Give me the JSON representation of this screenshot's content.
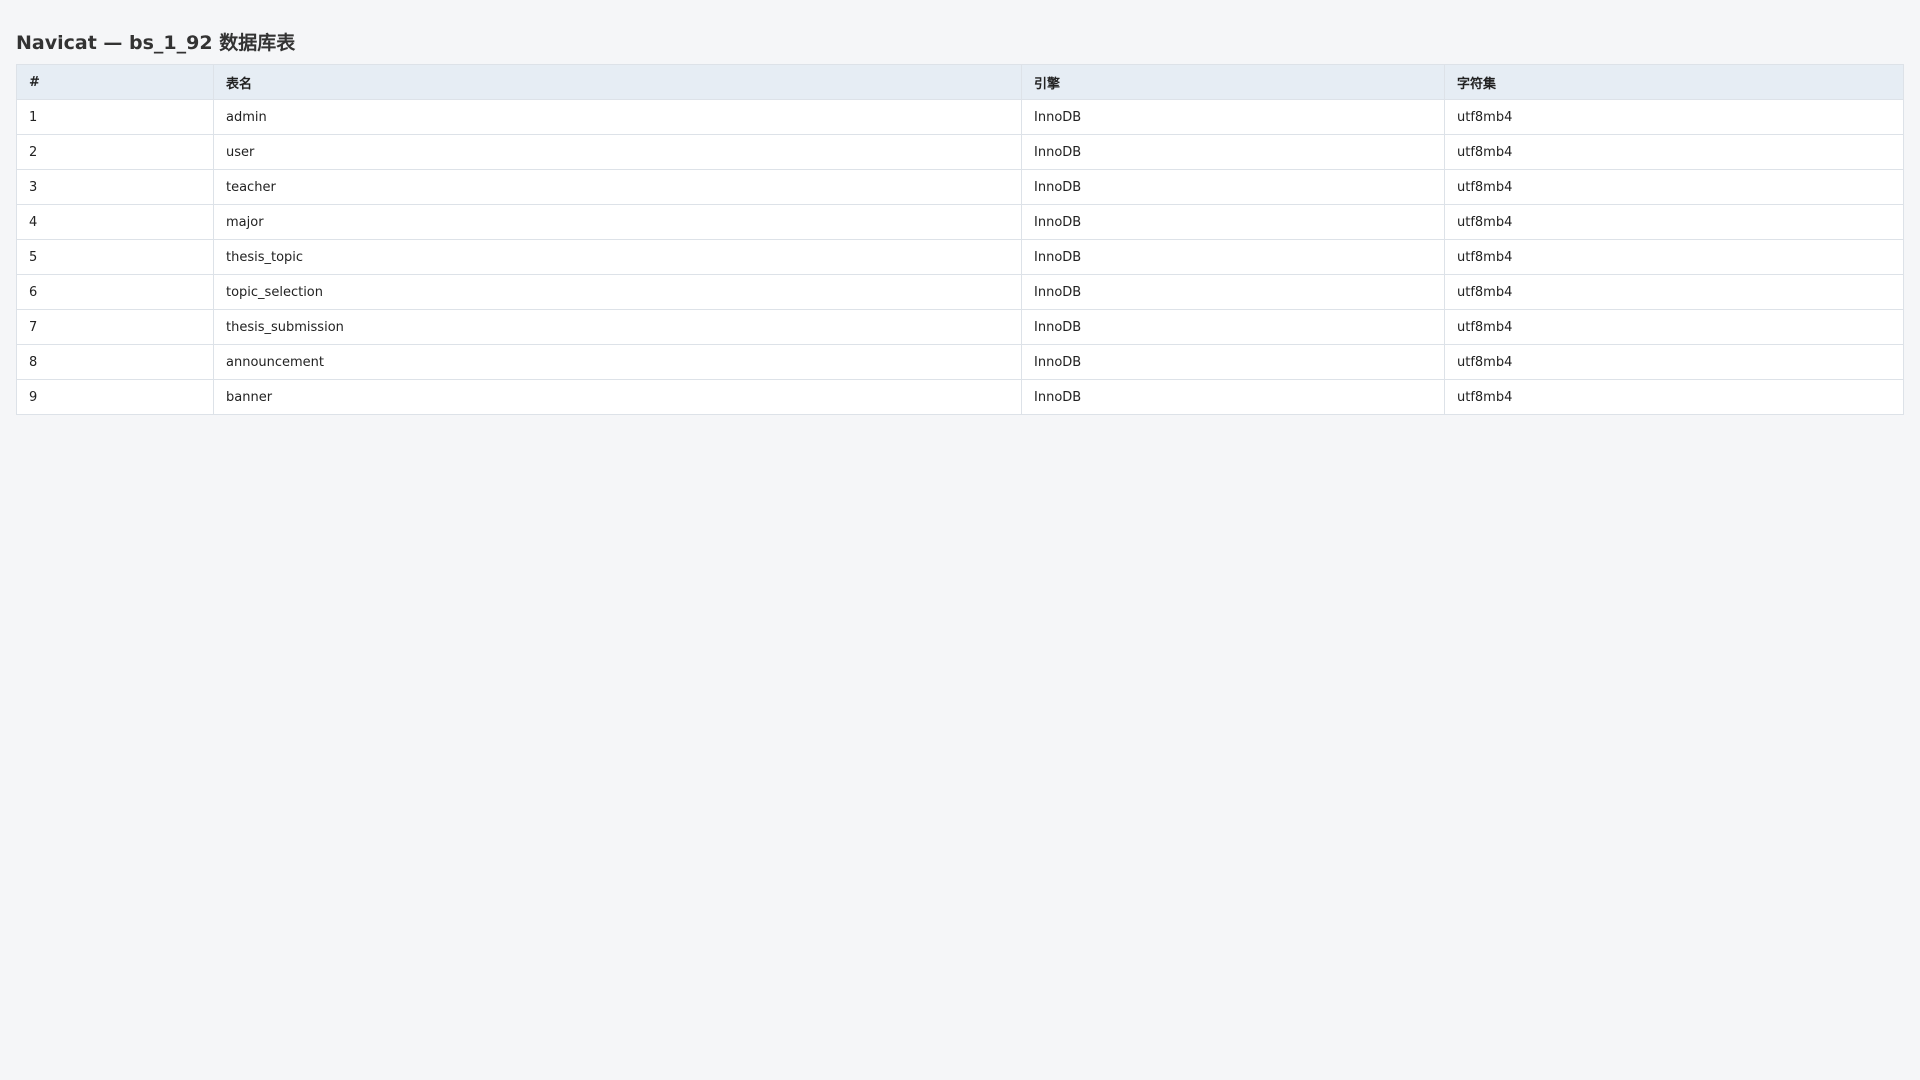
{
  "page": {
    "title": "Navicat — bs_1_92 数据库表"
  },
  "table": {
    "columns": [
      "#",
      "表名",
      "引擎",
      "字符集"
    ],
    "rows": [
      {
        "num": "1",
        "name": "admin",
        "engine": "InnoDB",
        "charset": "utf8mb4"
      },
      {
        "num": "2",
        "name": "user",
        "engine": "InnoDB",
        "charset": "utf8mb4"
      },
      {
        "num": "3",
        "name": "teacher",
        "engine": "InnoDB",
        "charset": "utf8mb4"
      },
      {
        "num": "4",
        "name": "major",
        "engine": "InnoDB",
        "charset": "utf8mb4"
      },
      {
        "num": "5",
        "name": "thesis_topic",
        "engine": "InnoDB",
        "charset": "utf8mb4"
      },
      {
        "num": "6",
        "name": "topic_selection",
        "engine": "InnoDB",
        "charset": "utf8mb4"
      },
      {
        "num": "7",
        "name": "thesis_submission",
        "engine": "InnoDB",
        "charset": "utf8mb4"
      },
      {
        "num": "8",
        "name": "announcement",
        "engine": "InnoDB",
        "charset": "utf8mb4"
      },
      {
        "num": "9",
        "name": "banner",
        "engine": "InnoDB",
        "charset": "utf8mb4"
      }
    ]
  },
  "colors": {
    "background": "#f5f6f8",
    "header_bg": "#e6edf4",
    "border": "#dde2e8",
    "row_bg": "#ffffff"
  }
}
